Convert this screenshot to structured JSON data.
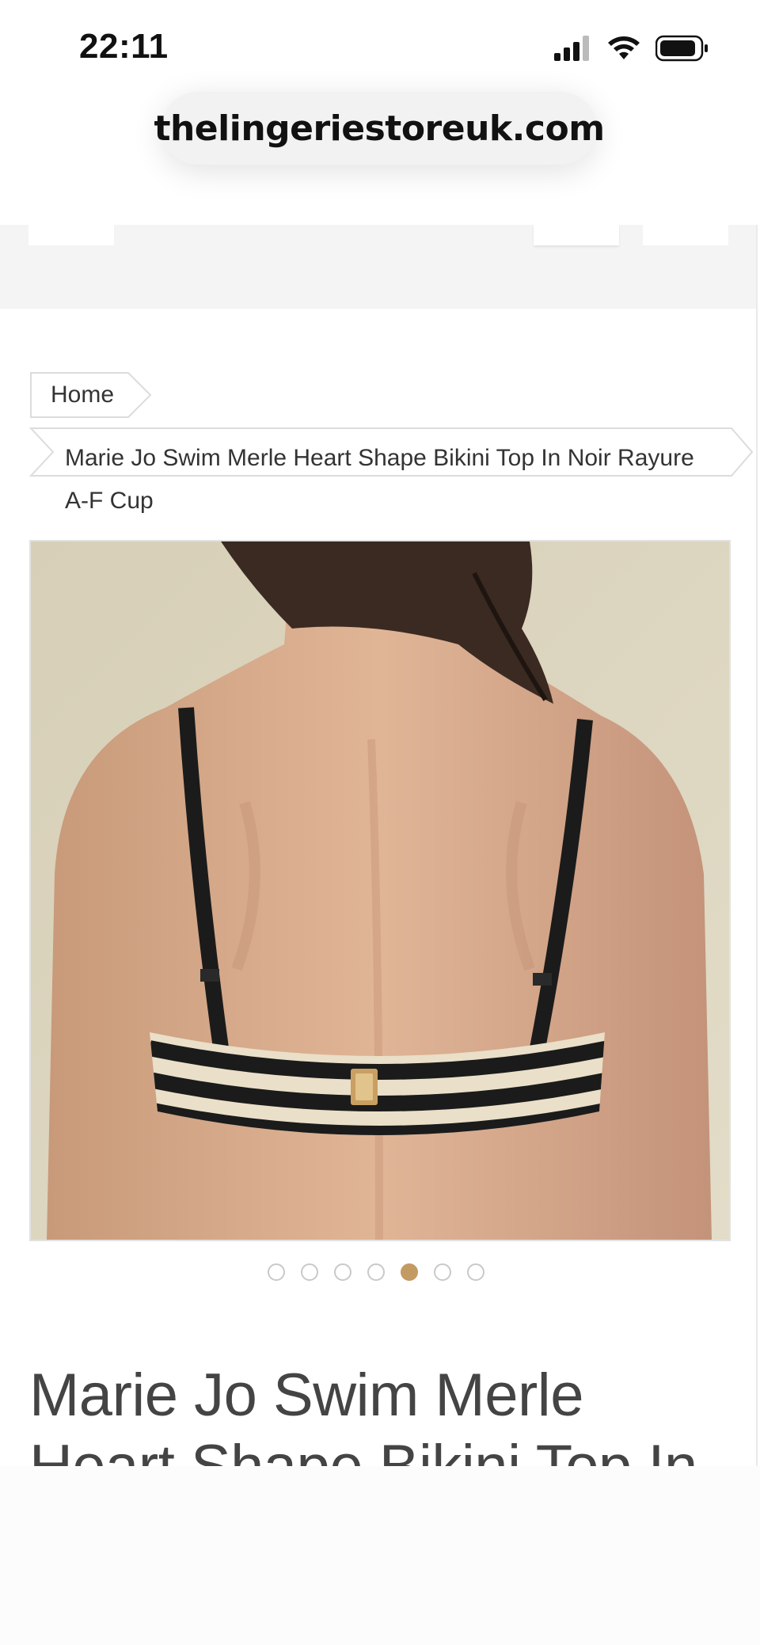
{
  "status_bar": {
    "time": "22:11",
    "icons": [
      "cellular-signal-icon",
      "wifi-icon",
      "battery-icon"
    ]
  },
  "browser": {
    "url": "thelingeriestoreuk.com"
  },
  "breadcrumb": {
    "items": [
      {
        "label": "Home"
      },
      {
        "label": "Marie Jo Swim Merle Heart Shape Bikini Top In Noir Rayure A-F Cup"
      }
    ]
  },
  "gallery": {
    "image_alt": "Back view of model wearing striped bikini top",
    "dot_count": 7,
    "active_index": 4
  },
  "product": {
    "title": "Marie Jo Swim Merle Heart Shape Bikini Top In Noir Rayure A-F Cup"
  },
  "colors": {
    "accent": "#c49a63",
    "text": "#444444",
    "background": "#ffffff",
    "strip": "#f4f4f4"
  }
}
